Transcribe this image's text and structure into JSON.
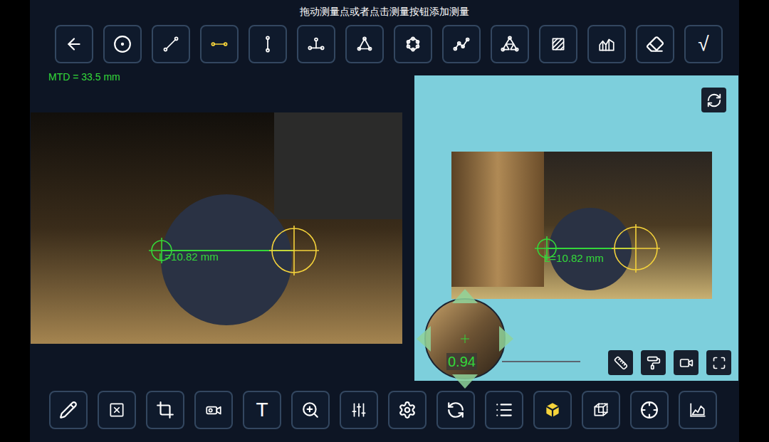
{
  "instruction": "拖动测量点或者点击测量按钮添加测量",
  "top_toolbar": [
    {
      "selected": false
    },
    {
      "selected": false
    },
    {
      "selected": false
    },
    {
      "selected": true
    },
    {
      "selected": false
    },
    {
      "selected": false
    },
    {
      "selected": false
    },
    {
      "selected": false
    },
    {
      "selected": false
    },
    {
      "selected": false
    },
    {
      "selected": false
    },
    {
      "selected": false
    },
    {
      "selected": false
    },
    {
      "glyph": "√",
      "selected": false
    }
  ],
  "mtd": "MTD = 33.5 mm",
  "left_view": {
    "measurement": "L=10.82 mm"
  },
  "right_view": {
    "measurement": "L=10.82 mm"
  },
  "magnifier": {
    "value": "0.94"
  },
  "bottom_toolbar": [
    {
      "selected": false
    },
    {
      "selected": false
    },
    {
      "selected": false
    },
    {
      "selected": false
    },
    {
      "glyph": "T",
      "selected": false
    },
    {
      "selected": false
    },
    {
      "selected": false
    },
    {
      "selected": false
    },
    {
      "selected": false
    },
    {
      "selected": false
    },
    {
      "selected": true
    },
    {
      "selected": false
    },
    {
      "selected": false
    },
    {
      "selected": false
    }
  ]
}
